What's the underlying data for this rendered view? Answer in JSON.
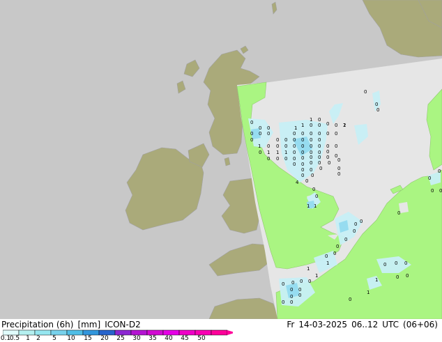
{
  "legend": {
    "parameter": "Precipitation (6h)",
    "unit": "[mm]",
    "model": "ICON-D2",
    "scale_labels": [
      "0.1",
      "0.5",
      "1",
      "2",
      "5",
      "10",
      "15",
      "20",
      "25",
      "30",
      "35",
      "40",
      "45",
      "50"
    ],
    "scale_colors": [
      "#e0fcfc",
      "#b4f0f0",
      "#96e6f0",
      "#78d2ec",
      "#50bee6",
      "#3296dc",
      "#2864cc",
      "#8c28d2",
      "#b414d2",
      "#d20ad2",
      "#e600e6",
      "#f000c8",
      "#fa00b4",
      "#ff009a"
    ]
  },
  "valid_time": {
    "day": "Fr",
    "date": "14-03-2025",
    "hours": "06..12",
    "tz": "UTC",
    "range": "(06+06)"
  },
  "map": {
    "colors": {
      "sea_outside": "#c8c8c8",
      "land_outside": "#aaaa7a",
      "sea_domain": "#e6e6e6",
      "land_domain": "#aaf582",
      "coast": "#a0a0a0",
      "precip_light": "#c8f0f6",
      "precip_mid": "#96dcf0"
    },
    "value_labels": [
      "0",
      "0",
      "0",
      "0",
      "0",
      "0",
      "0",
      "1",
      "1",
      "0",
      "0",
      "0",
      "0",
      "1",
      "1",
      "0",
      "0",
      "0",
      "0",
      "0",
      "0",
      "0",
      "0",
      "0",
      "0",
      "0",
      "0",
      "0",
      "2",
      "1",
      "0",
      "0",
      "0",
      "0",
      "0",
      "0",
      "0",
      "0",
      "0",
      "0",
      "1",
      "1",
      "1",
      "0",
      "0",
      "0",
      "0",
      "0",
      "0",
      "0",
      "0",
      "0",
      "0",
      "0",
      "0",
      "0",
      "0",
      "0",
      "0",
      "0",
      "0",
      "0",
      "0",
      "0",
      "0",
      "0",
      "0",
      "0",
      "0",
      "0",
      "4",
      "0",
      "1",
      "1",
      "0",
      "0",
      "0",
      "0",
      "0",
      "0",
      "0",
      "0",
      "0",
      "1",
      "1",
      "1",
      "0",
      "0",
      "0",
      "0",
      "0",
      "0",
      "0",
      "0",
      "0",
      "0",
      "0",
      "1",
      "1",
      "0",
      "0",
      "0",
      "0",
      "0",
      "0",
      "0",
      "0",
      "0",
      "0",
      "0",
      "0",
      "0"
    ]
  }
}
